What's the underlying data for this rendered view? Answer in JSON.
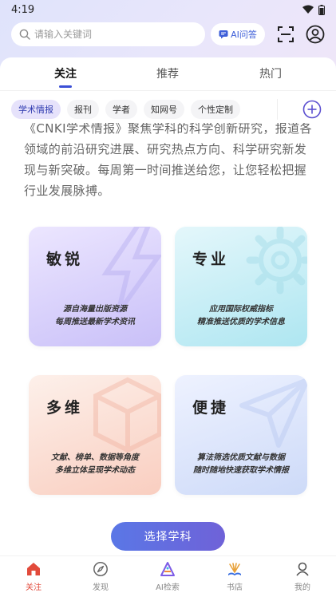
{
  "status_bar": {
    "time": "4:19"
  },
  "search": {
    "placeholder": "请输入关键词"
  },
  "header": {
    "ai_button_label": "AI问答"
  },
  "tabs": [
    {
      "label": "关注",
      "active": true
    },
    {
      "label": "推荐",
      "active": false
    },
    {
      "label": "热门",
      "active": false
    }
  ],
  "chips": [
    {
      "label": "学术情报",
      "active": true
    },
    {
      "label": "报刊",
      "active": false
    },
    {
      "label": "学者",
      "active": false
    },
    {
      "label": "知网号",
      "active": false
    },
    {
      "label": "个性定制",
      "active": false
    }
  ],
  "intro": {
    "text": "《CNKI学术情报》聚焦学科的科学创新研究，报道各领域的前沿研究进展、研究热点方向、科学研究新发现与新突破。每周第一时间推送给您，让您轻松把握行业发展脉搏。"
  },
  "cards": [
    {
      "title": "敏锐",
      "line1": "源自海量出版资源",
      "line2": "每周推送最新学术资讯"
    },
    {
      "title": "专业",
      "line1": "应用国际权威指标",
      "line2": "精准推送优质的学术信息"
    },
    {
      "title": "多维",
      "line1": "文献、榜单、数据等角度",
      "line2": "多维立体呈现学术动态"
    },
    {
      "title": "便捷",
      "line1": "算法筛选优质文献与数据",
      "line2": "随时随地快速获取学术情报"
    }
  ],
  "select_button": {
    "label": "选择学科"
  },
  "bottom_nav": [
    {
      "label": "关注",
      "icon": "home-icon",
      "active": true
    },
    {
      "label": "发现",
      "icon": "compass-icon",
      "active": false
    },
    {
      "label": "AI检索",
      "icon": "ai-search-icon",
      "active": false
    },
    {
      "label": "书店",
      "icon": "bookstore-icon",
      "active": false
    },
    {
      "label": "我的",
      "icon": "profile-icon",
      "active": false
    }
  ],
  "colors": {
    "accent": "#3b4fd6",
    "active_nav": "#e24a3b",
    "button_gradient_start": "#5a77e6",
    "button_gradient_end": "#6f62d8"
  }
}
